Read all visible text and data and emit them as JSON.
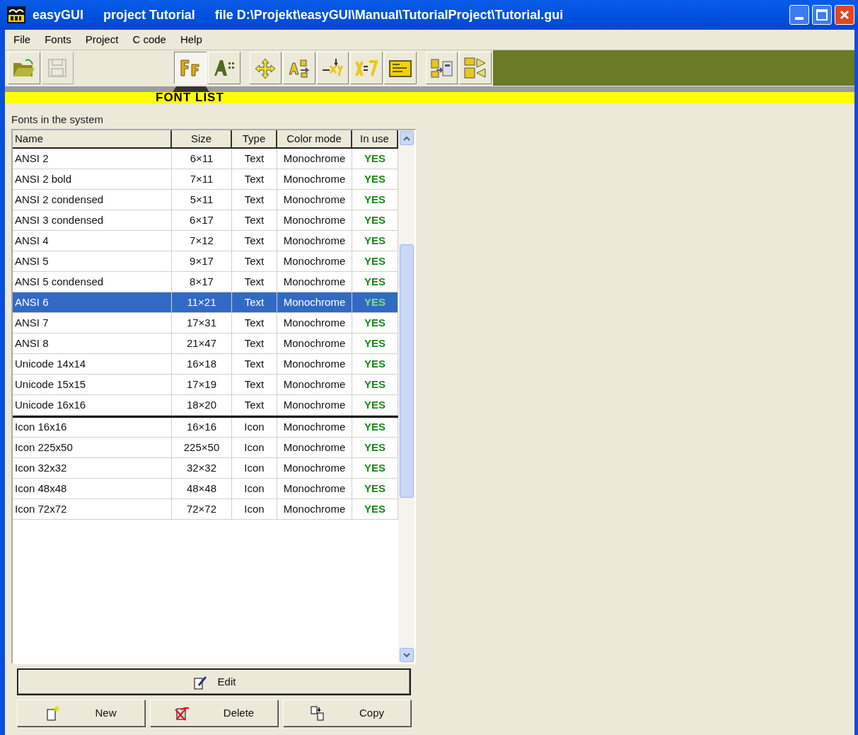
{
  "window": {
    "title_parts": [
      "easyGUI",
      "project Tutorial",
      "file D:\\Projekt\\easyGUI\\Manual\\TutorialProject\\Tutorial.gui"
    ]
  },
  "menu": [
    "File",
    "Fonts",
    "Project",
    "C code",
    "Help"
  ],
  "toolbar_groups": [
    [
      {
        "kind": "open",
        "selected": false,
        "disabled": false
      },
      {
        "kind": "save",
        "selected": false,
        "disabled": true
      }
    ],
    [
      {
        "kind": "fonts",
        "selected": true,
        "disabled": false
      },
      {
        "kind": "font-edit",
        "selected": false,
        "disabled": false
      }
    ],
    [
      {
        "kind": "move",
        "selected": false,
        "disabled": false
      },
      {
        "kind": "text-list",
        "selected": false,
        "disabled": false
      },
      {
        "kind": "xy",
        "selected": false,
        "disabled": false
      },
      {
        "kind": "variable",
        "selected": false,
        "disabled": false
      },
      {
        "kind": "screen",
        "selected": false,
        "disabled": false
      }
    ],
    [
      {
        "kind": "generate",
        "selected": false,
        "disabled": false
      },
      {
        "kind": "compare",
        "selected": false,
        "disabled": false
      }
    ]
  ],
  "tab_label": "FONT LIST",
  "section_label": "Fonts in the system",
  "table": {
    "columns": [
      "Name",
      "Size",
      "Type",
      "Color mode",
      "In use"
    ],
    "rows": [
      {
        "name": "ANSI 2",
        "size": "6×11",
        "type": "Text",
        "color_mode": "Monochrome",
        "in_use": "YES",
        "selected": false,
        "group_start": false
      },
      {
        "name": "ANSI 2 bold",
        "size": "7×11",
        "type": "Text",
        "color_mode": "Monochrome",
        "in_use": "YES",
        "selected": false,
        "group_start": false
      },
      {
        "name": "ANSI 2 condensed",
        "size": "5×11",
        "type": "Text",
        "color_mode": "Monochrome",
        "in_use": "YES",
        "selected": false,
        "group_start": false
      },
      {
        "name": "ANSI 3 condensed",
        "size": "6×17",
        "type": "Text",
        "color_mode": "Monochrome",
        "in_use": "YES",
        "selected": false,
        "group_start": false
      },
      {
        "name": "ANSI 4",
        "size": "7×12",
        "type": "Text",
        "color_mode": "Monochrome",
        "in_use": "YES",
        "selected": false,
        "group_start": false
      },
      {
        "name": "ANSI 5",
        "size": "9×17",
        "type": "Text",
        "color_mode": "Monochrome",
        "in_use": "YES",
        "selected": false,
        "group_start": false
      },
      {
        "name": "ANSI 5 condensed",
        "size": "8×17",
        "type": "Text",
        "color_mode": "Monochrome",
        "in_use": "YES",
        "selected": false,
        "group_start": false
      },
      {
        "name": "ANSI 6",
        "size": "11×21",
        "type": "Text",
        "color_mode": "Monochrome",
        "in_use": "YES",
        "selected": true,
        "group_start": false
      },
      {
        "name": "ANSI 7",
        "size": "17×31",
        "type": "Text",
        "color_mode": "Monochrome",
        "in_use": "YES",
        "selected": false,
        "group_start": false
      },
      {
        "name": "ANSI 8",
        "size": "21×47",
        "type": "Text",
        "color_mode": "Monochrome",
        "in_use": "YES",
        "selected": false,
        "group_start": false
      },
      {
        "name": "Unicode 14x14",
        "size": "16×18",
        "type": "Text",
        "color_mode": "Monochrome",
        "in_use": "YES",
        "selected": false,
        "group_start": false
      },
      {
        "name": "Unicode 15x15",
        "size": "17×19",
        "type": "Text",
        "color_mode": "Monochrome",
        "in_use": "YES",
        "selected": false,
        "group_start": false
      },
      {
        "name": "Unicode 16x16",
        "size": "18×20",
        "type": "Text",
        "color_mode": "Monochrome",
        "in_use": "YES",
        "selected": false,
        "group_start": false
      },
      {
        "name": "Icon 16x16",
        "size": "16×16",
        "type": "Icon",
        "color_mode": "Monochrome",
        "in_use": "YES",
        "selected": false,
        "group_start": true
      },
      {
        "name": "Icon 225x50",
        "size": "225×50",
        "type": "Icon",
        "color_mode": "Monochrome",
        "in_use": "YES",
        "selected": false,
        "group_start": false
      },
      {
        "name": "Icon 32x32",
        "size": "32×32",
        "type": "Icon",
        "color_mode": "Monochrome",
        "in_use": "YES",
        "selected": false,
        "group_start": false
      },
      {
        "name": "Icon 48x48",
        "size": "48×48",
        "type": "Icon",
        "color_mode": "Monochrome",
        "in_use": "YES",
        "selected": false,
        "group_start": false
      },
      {
        "name": "Icon 72x72",
        "size": "72×72",
        "type": "Icon",
        "color_mode": "Monochrome",
        "in_use": "YES",
        "selected": false,
        "group_start": false
      }
    ]
  },
  "buttons": [
    {
      "label": "Edit",
      "kind": "edit",
      "default": true
    },
    {
      "label": "New",
      "kind": "new",
      "default": false
    },
    {
      "label": "Delete",
      "kind": "delete",
      "default": false
    },
    {
      "label": "Copy",
      "kind": "copy",
      "default": false
    }
  ]
}
